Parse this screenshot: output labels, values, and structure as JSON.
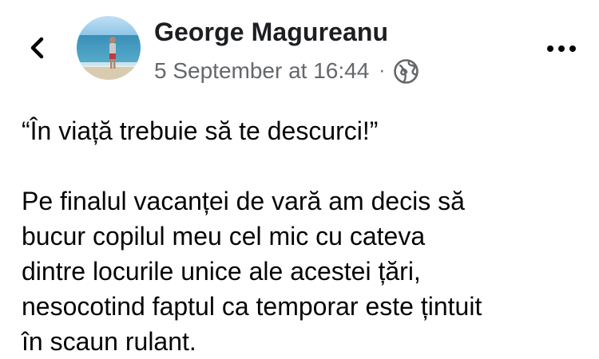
{
  "header": {
    "back_icon": "chevron-left-icon",
    "author_name": "George Magureanu",
    "timestamp": "5 September at 16:44",
    "separator": "·",
    "audience_icon": "globe-icon",
    "more_icon": "more-horizontal-icon"
  },
  "post": {
    "quote": "“În viață trebuie să te descurci!”",
    "lines": [
      "Pe finalul vacanței de vară am decis să",
      "bucur copilul meu cel mic cu cateva",
      "dintre locurile unice ale acestei țări,",
      "nesocotind faptul ca temporar este țintuit",
      "în scaun rulant."
    ]
  },
  "colors": {
    "name_text": "#1c1e21",
    "meta_text": "#65676b",
    "body_text": "#050505"
  }
}
